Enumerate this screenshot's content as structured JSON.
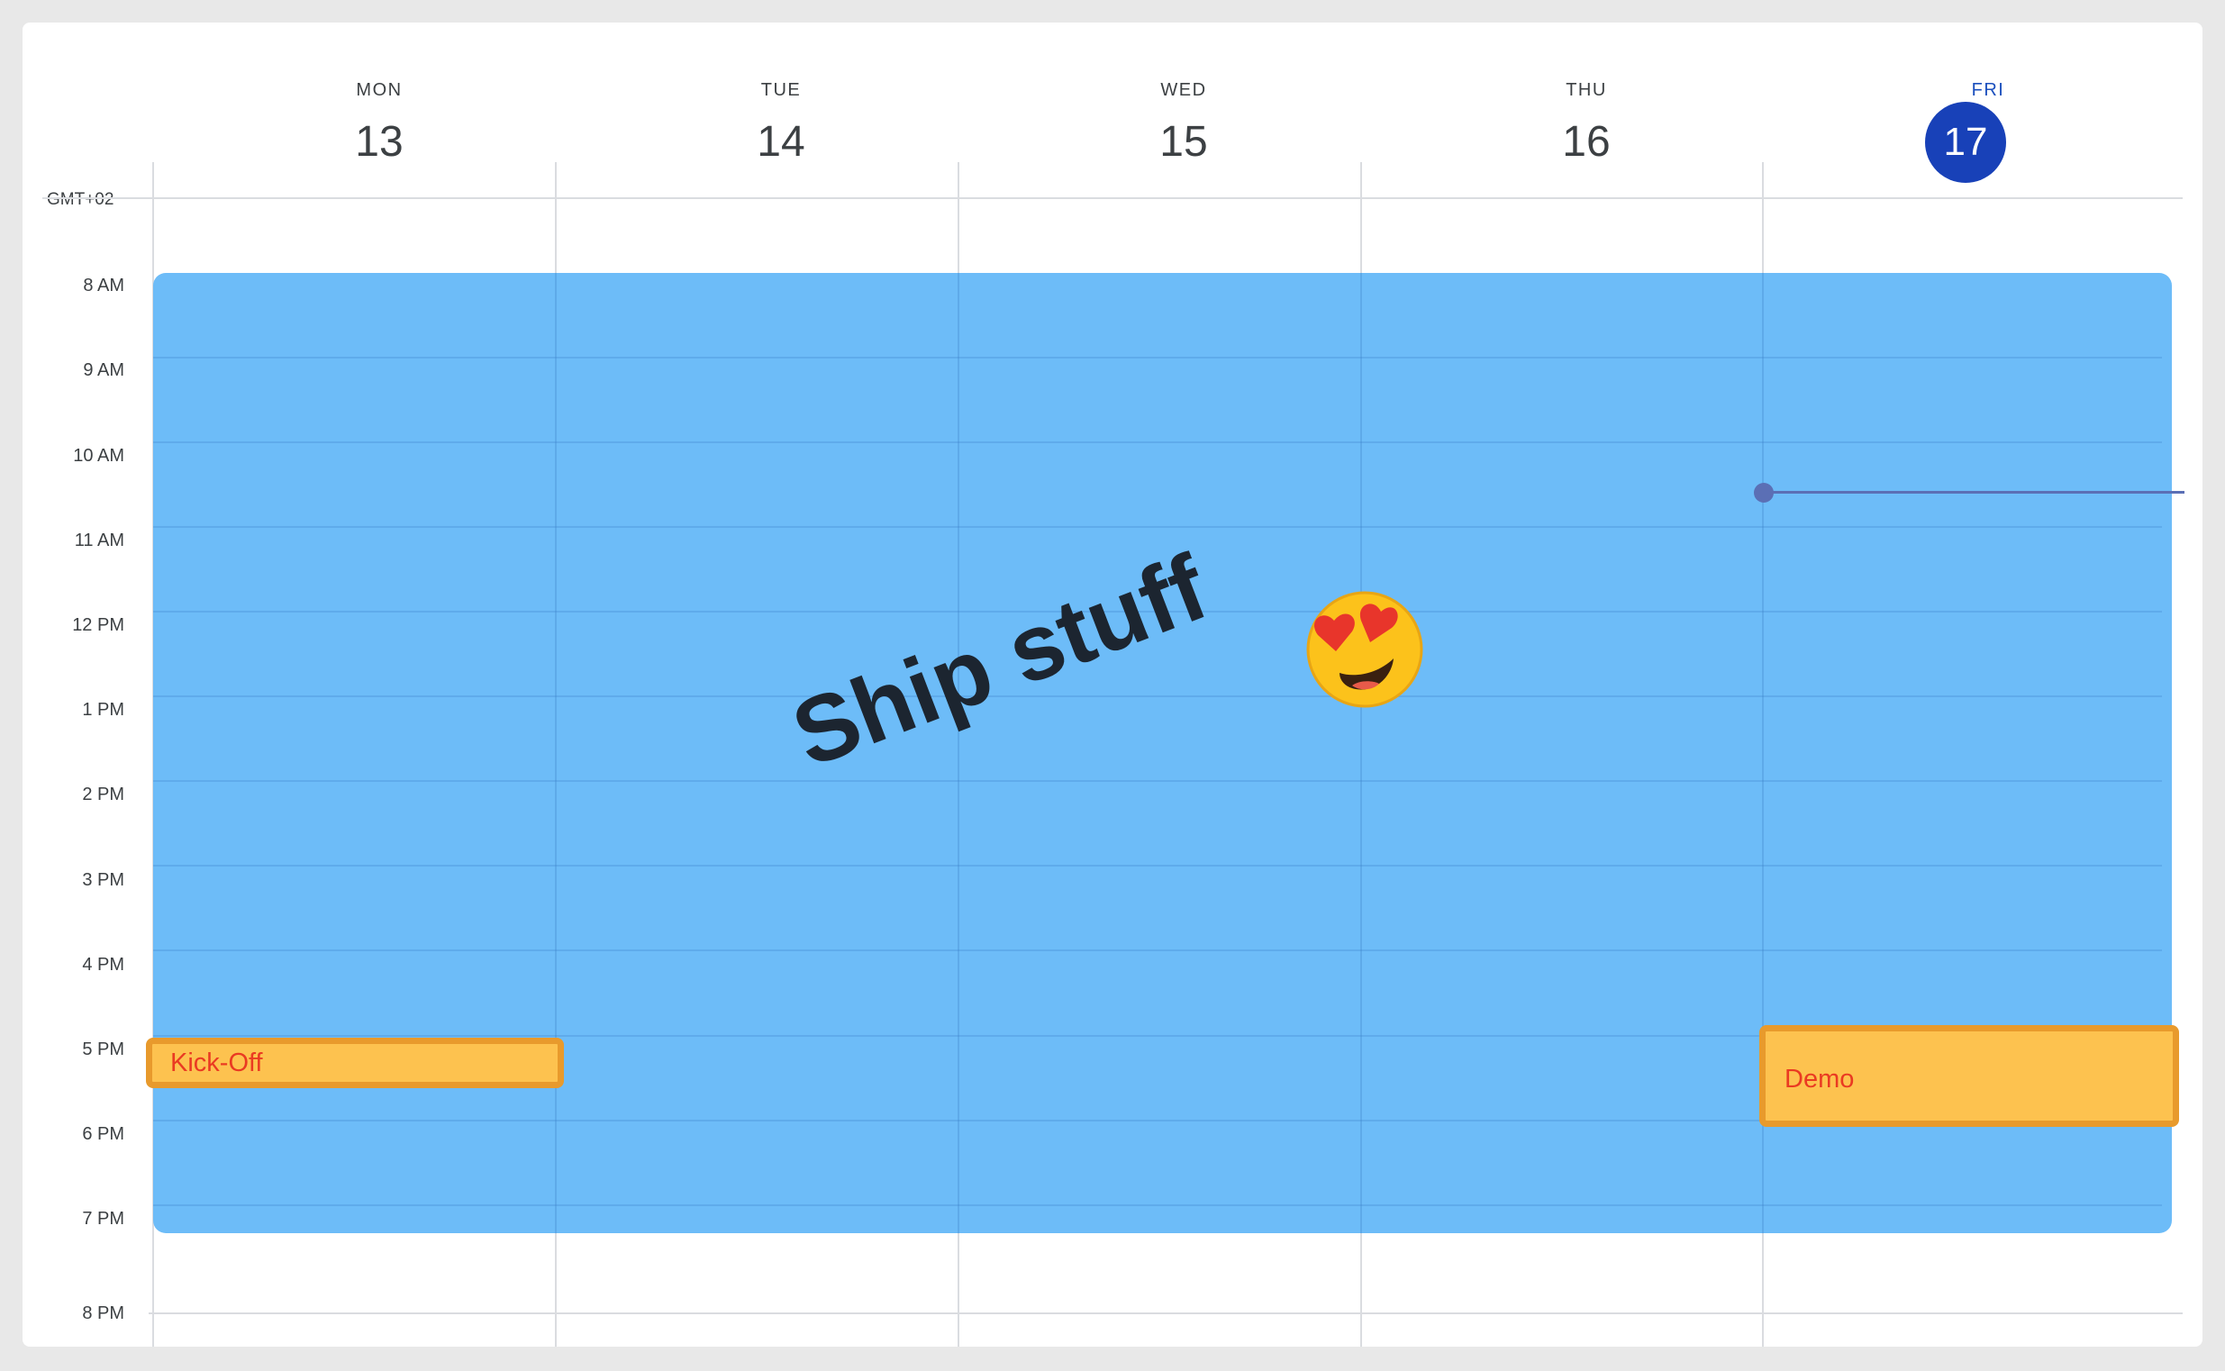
{
  "timezone": "GMT+02",
  "days": [
    {
      "name": "MON",
      "num": "13"
    },
    {
      "name": "TUE",
      "num": "14"
    },
    {
      "name": "WED",
      "num": "15"
    },
    {
      "name": "THU",
      "num": "16"
    },
    {
      "name": "FRI",
      "num": "17"
    }
  ],
  "today_index": 4,
  "hours": [
    "8 AM",
    "9 AM",
    "10 AM",
    "11 AM",
    "12 PM",
    "1 PM",
    "2 PM",
    "3 PM",
    "4 PM",
    "5 PM",
    "6 PM",
    "7 PM",
    "8 PM"
  ],
  "events": {
    "all_week": {
      "title": "Ship stuff",
      "emoji": "😍",
      "color": "#6dbbf7"
    },
    "kickoff": {
      "title": "Kick-Off",
      "color": "#fdc24f"
    },
    "demo": {
      "title": "Demo",
      "color": "#fdc24f"
    }
  },
  "colors": {
    "today_accent": "#1841b8",
    "event_border": "#e89a2c",
    "event_text": "#ea3a22",
    "now_indicator": "#5b6fb5"
  }
}
